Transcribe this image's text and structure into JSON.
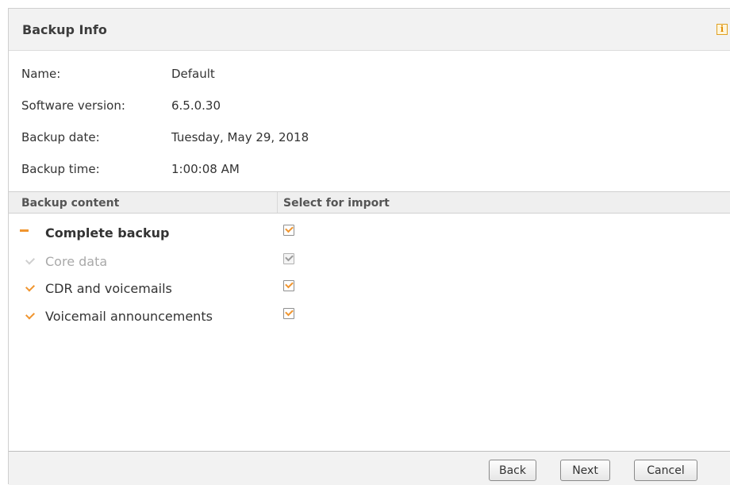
{
  "header": {
    "title": "Backup Info",
    "info_icon": "info-icon"
  },
  "info": {
    "name_label": "Name:",
    "name_value": "Default",
    "version_label": "Software version:",
    "version_value": "6.5.0.30",
    "date_label": "Backup date:",
    "date_value": "Tuesday, May 29, 2018",
    "time_label": "Backup time:",
    "time_value": "1:00:08 AM"
  },
  "table": {
    "col_content": "Backup content",
    "col_select": "Select for import",
    "rows": [
      {
        "label": "Complete backup",
        "checked": true,
        "enabled": true,
        "expanded": true
      },
      {
        "label": "Core data",
        "checked": true,
        "enabled": false
      },
      {
        "label": "CDR and voicemails",
        "checked": true,
        "enabled": true
      },
      {
        "label": "Voicemail announcements",
        "checked": true,
        "enabled": true
      }
    ]
  },
  "buttons": {
    "back": "Back",
    "next": "Next",
    "cancel": "Cancel"
  },
  "colors": {
    "accent": "#f0952f",
    "disabled_text": "#a9a9a9"
  }
}
